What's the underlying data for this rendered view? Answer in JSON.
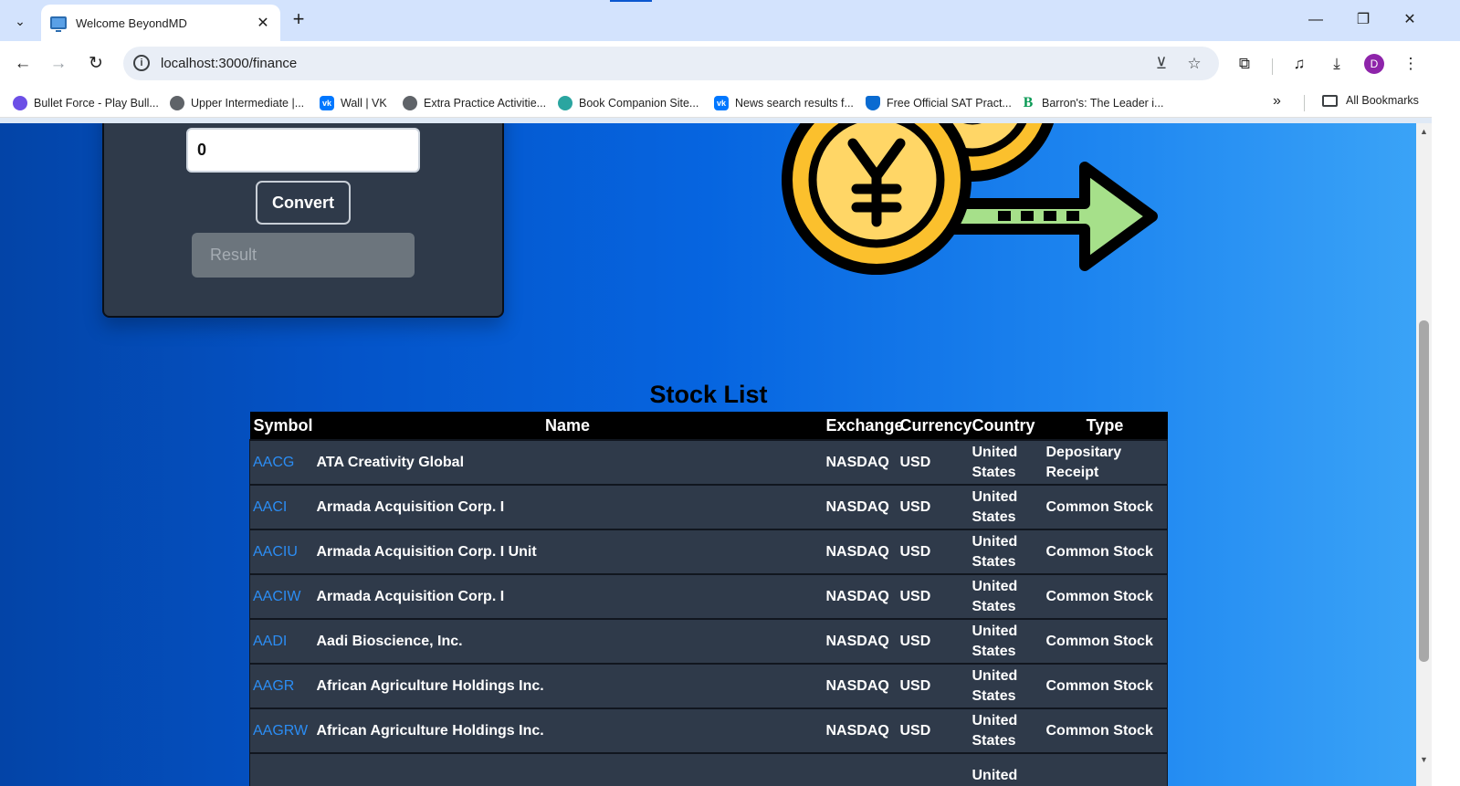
{
  "browser": {
    "tab_title": "Welcome BeyondMD",
    "url": "localhost:3000/finance",
    "profile_initial": "D",
    "bookmarks": [
      {
        "label": "Bullet Force - Play Bull...",
        "color": "#6c4fe6"
      },
      {
        "label": "Upper Intermediate |...",
        "color": "#5f6368"
      },
      {
        "label": "Wall | VK",
        "color": "#0077ff"
      },
      {
        "label": "Extra Practice Activitie...",
        "color": "#5f6368"
      },
      {
        "label": "Book Companion Site...",
        "color": "#2aa5a0"
      },
      {
        "label": "News search results f...",
        "color": "#0077ff"
      },
      {
        "label": "Free Official SAT Pract...",
        "color": "#0a6bd1"
      },
      {
        "label": "Barron's: The Leader i...",
        "color": "#0c9a56"
      }
    ],
    "all_bookmarks_label": "All Bookmarks"
  },
  "converter": {
    "amount_value": "0",
    "convert_label": "Convert",
    "result_placeholder": "Result"
  },
  "stocks": {
    "title": "Stock List",
    "headers": {
      "symbol": "Symbol",
      "name": "Name",
      "exchange": "Exchange",
      "currency": "Currency",
      "country": "Country",
      "type": "Type"
    },
    "rows": [
      {
        "symbol": "AACG",
        "name": "ATA Creativity Global",
        "exchange": "NASDAQ",
        "currency": "USD",
        "country": "United States",
        "type": "Depositary Receipt"
      },
      {
        "symbol": "AACI",
        "name": "Armada Acquisition Corp. I",
        "exchange": "NASDAQ",
        "currency": "USD",
        "country": "United States",
        "type": "Common Stock"
      },
      {
        "symbol": "AACIU",
        "name": "Armada Acquisition Corp. I Unit",
        "exchange": "NASDAQ",
        "currency": "USD",
        "country": "United States",
        "type": "Common Stock"
      },
      {
        "symbol": "AACIW",
        "name": "Armada Acquisition Corp. I",
        "exchange": "NASDAQ",
        "currency": "USD",
        "country": "United States",
        "type": "Common Stock"
      },
      {
        "symbol": "AADI",
        "name": "Aadi Bioscience, Inc.",
        "exchange": "NASDAQ",
        "currency": "USD",
        "country": "United States",
        "type": "Common Stock"
      },
      {
        "symbol": "AAGR",
        "name": "African Agriculture Holdings Inc.",
        "exchange": "NASDAQ",
        "currency": "USD",
        "country": "United States",
        "type": "Common Stock"
      },
      {
        "symbol": "AAGRW",
        "name": "African Agriculture Holdings Inc.",
        "exchange": "NASDAQ",
        "currency": "USD",
        "country": "United States",
        "type": "Common Stock"
      },
      {
        "symbol": "",
        "name": "",
        "exchange": "",
        "currency": "",
        "country": "United",
        "type": ""
      }
    ]
  },
  "icons": {
    "tab_search": "chevron-down-icon",
    "back": "arrow-left-icon",
    "forward": "arrow-right-icon",
    "reload": "reload-icon",
    "illustration": "currency-exchange-illustration"
  }
}
